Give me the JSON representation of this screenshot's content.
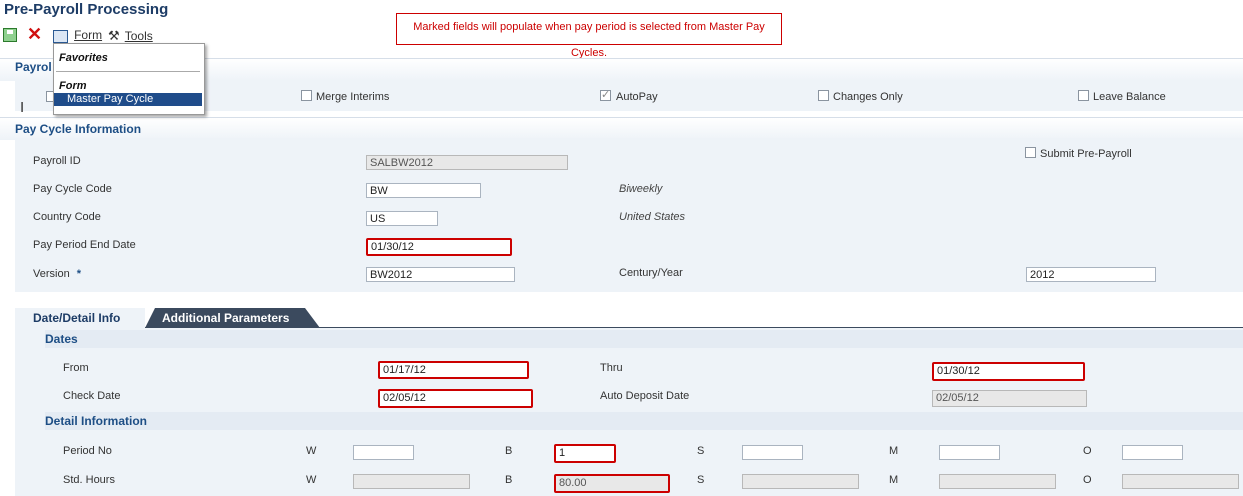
{
  "app": {
    "title": "Pre-Payroll Processing"
  },
  "toolbar": {
    "save_icon": "save-icon",
    "cancel_icon": "close-icon",
    "form_label": "Form",
    "tools_label": "Tools"
  },
  "note": "Marked fields will populate when pay period is selected from Master Pay Cycles.",
  "menu": {
    "favorites": "Favorites",
    "form_header": "Form",
    "item": "Master Pay Cycle"
  },
  "payroll_section": {
    "title": "Payrol"
  },
  "options": {
    "merge_interims": "Merge Interims",
    "autopay": "AutoPay",
    "changes_only": "Changes Only",
    "leave_balance": "Leave Balance"
  },
  "pay_cycle": {
    "title": "Pay Cycle Information",
    "payroll_id_label": "Payroll ID",
    "payroll_id": "SALBW2012",
    "pay_cycle_code_label": "Pay Cycle Code",
    "pay_cycle_code": "BW",
    "pay_cycle_desc": "Biweekly",
    "country_code_label": "Country Code",
    "country_code": "US",
    "country_desc": "United States",
    "period_end_label": "Pay Period End Date",
    "period_end": "01/30/12",
    "version_label": "Version",
    "required_mark": "*",
    "version": "BW2012",
    "century_year_label": "Century/Year",
    "century_year": "2012",
    "submit_label": "Submit Pre-Payroll"
  },
  "tabs": {
    "date_detail": "Date/Detail Info",
    "additional": "Additional Parameters"
  },
  "dates": {
    "title": "Dates",
    "from_label": "From",
    "from": "01/17/12",
    "thru_label": "Thru",
    "thru": "01/30/12",
    "check_date_label": "Check Date",
    "check_date": "02/05/12",
    "auto_deposit_label": "Auto Deposit Date",
    "auto_deposit": "02/05/12"
  },
  "detail": {
    "title": "Detail Information",
    "period_no_label": "Period No",
    "std_hours_label": "Std. Hours",
    "w": "W",
    "b": "B",
    "s": "S",
    "m": "M",
    "o": "O",
    "period_b": "1",
    "hours_b": "80.00"
  },
  "colors": {
    "accent": "#1d4e85",
    "highlight": "#cc0000",
    "panel": "#eef3f8"
  }
}
